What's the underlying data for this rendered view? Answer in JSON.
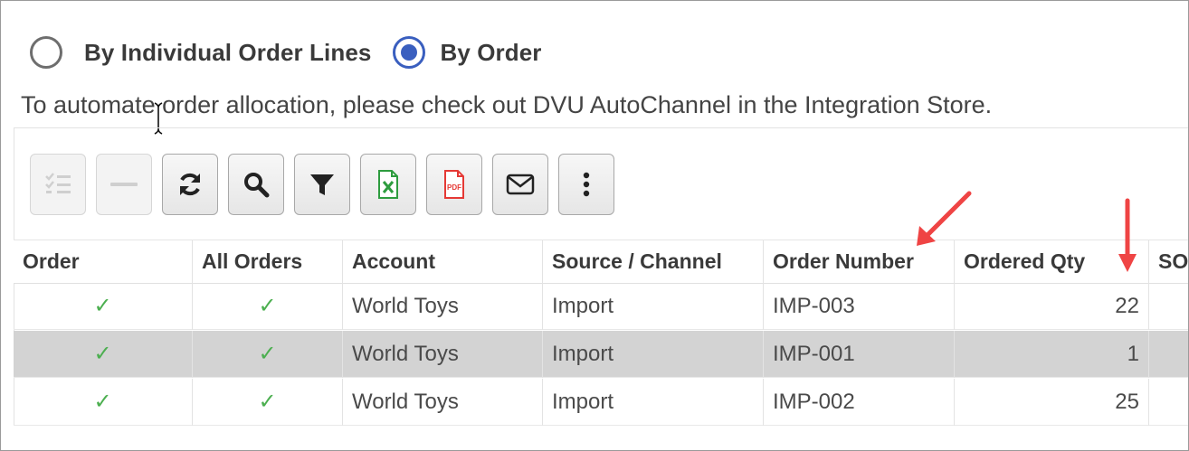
{
  "allocation_mode": {
    "options": [
      {
        "label": "By Individual Order Lines",
        "selected": false
      },
      {
        "label": "By Order",
        "selected": true
      }
    ]
  },
  "info_text": "To automate order allocation, please check out DVU AutoChannel in the Integration Store.",
  "toolbar": {
    "buttons": [
      {
        "icon": "list-check-icon",
        "enabled": false
      },
      {
        "icon": "minus-icon",
        "enabled": false
      },
      {
        "icon": "refresh-icon",
        "enabled": true
      },
      {
        "icon": "search-icon",
        "enabled": true
      },
      {
        "icon": "filter-icon",
        "enabled": true
      },
      {
        "icon": "excel-export-icon",
        "enabled": true
      },
      {
        "icon": "pdf-export-icon",
        "enabled": true
      },
      {
        "icon": "email-icon",
        "enabled": true
      },
      {
        "icon": "more-vertical-icon",
        "enabled": true
      }
    ]
  },
  "table": {
    "columns": [
      "Order",
      "All Orders",
      "Account",
      "Source / Channel",
      "Order Number",
      "Ordered Qty",
      "SO"
    ],
    "rows": [
      {
        "order": "✓",
        "all_orders": "✓",
        "account": "World Toys",
        "source": "Import",
        "order_number": "IMP-003",
        "ordered_qty": "22",
        "selected": false
      },
      {
        "order": "✓",
        "all_orders": "✓",
        "account": "World Toys",
        "source": "Import",
        "order_number": "IMP-001",
        "ordered_qty": "1",
        "selected": true
      },
      {
        "order": "✓",
        "all_orders": "✓",
        "account": "World Toys",
        "source": "Import",
        "order_number": "IMP-002",
        "ordered_qty": "25",
        "selected": false
      }
    ]
  },
  "colors": {
    "radio_selected": "#3a5fbf",
    "check_green": "#4caf50",
    "annotation_arrow": "#ef4444",
    "selected_row": "#d3d3d3"
  }
}
